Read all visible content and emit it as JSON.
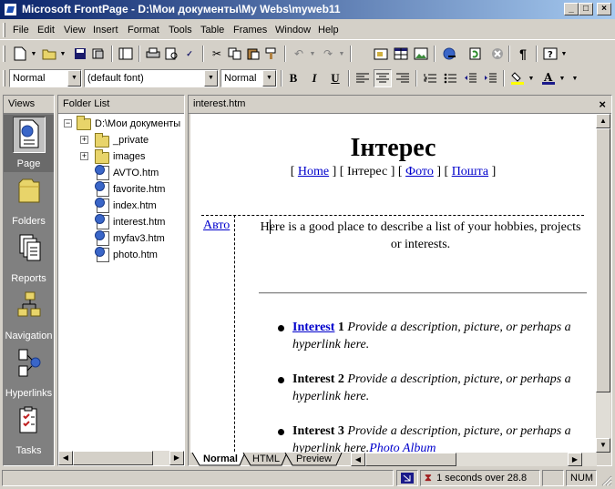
{
  "window": {
    "title": "Microsoft FrontPage - D:\\Мои документы\\My Webs\\myweb11",
    "minimize_glyph": "_",
    "maximize_glyph": "□",
    "close_glyph": "×"
  },
  "menu": [
    "File",
    "Edit",
    "View",
    "Insert",
    "Format",
    "Tools",
    "Table",
    "Frames",
    "Window",
    "Help"
  ],
  "formatting": {
    "style_value": "Normal",
    "font_value": "(default font)",
    "size_value": "Normal",
    "bold": "B",
    "italic": "I",
    "underline": "U"
  },
  "views": {
    "header": "Views",
    "items": [
      "Page",
      "Folders",
      "Reports",
      "Navigation",
      "Hyperlinks",
      "Tasks"
    ]
  },
  "folder_list": {
    "header": "Folder List",
    "root": "D:\\Мои документы",
    "items": [
      "_private",
      "images",
      "AVTO.htm",
      "favorite.htm",
      "index.htm",
      "interest.htm",
      "myfav3.htm",
      "photo.htm"
    ]
  },
  "document": {
    "tab_title": "interest.htm",
    "close_glyph": "×",
    "heading": "Інтерес",
    "nav": {
      "open": "[ ",
      "home": "Home",
      "sep1": " ] [ Інтерес ] [ ",
      "foto": "Фото",
      "sep2": " ] [ ",
      "poshta": "Пошта",
      "close": " ]"
    },
    "side_link": "Авто",
    "intro": "Here is a good place to describe a list of your hobbies, projects or interests.",
    "items": [
      {
        "title": "Interest",
        "num": " 1",
        "desc": " Provide a description, picture, or perhaps a hyperlink here.",
        "extra": ""
      },
      {
        "title": "Interest 2",
        "num": "",
        "desc": " Provide a description, picture, or perhaps a hyperlink here.",
        "extra": ""
      },
      {
        "title": "Interest 3",
        "num": "",
        "desc": " Provide a description, picture, or perhaps a hyperlink here.",
        "extra": "Photo Album"
      }
    ],
    "view_tabs": [
      "Normal",
      "HTML",
      "Preview"
    ]
  },
  "status": {
    "timing": "1 seconds over 28.8",
    "num": "NUM"
  }
}
